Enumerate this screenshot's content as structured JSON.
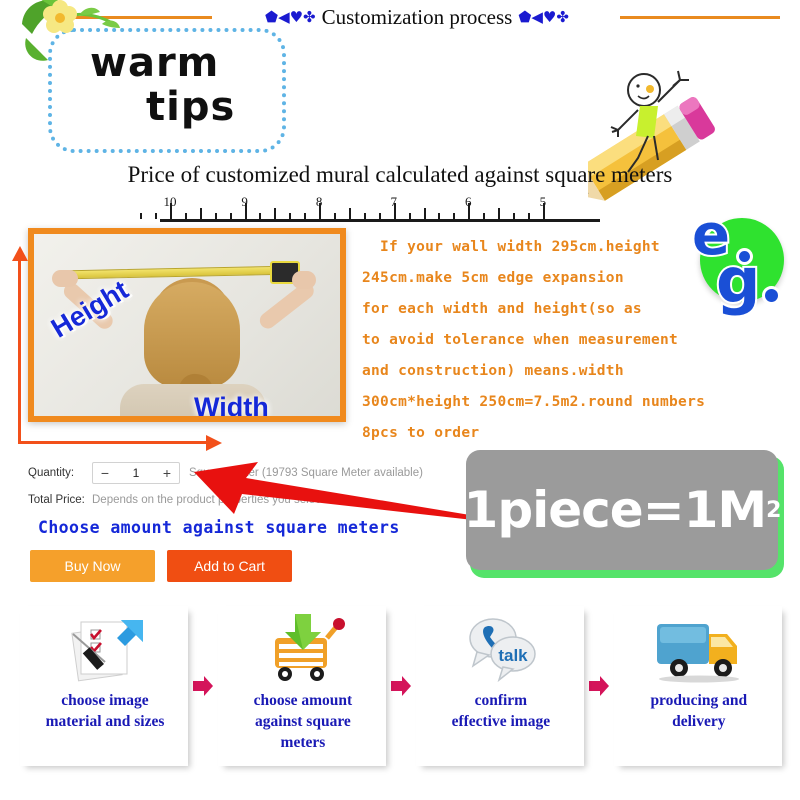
{
  "header": {
    "title": "Customization process",
    "suits_left": "⬟◀♥✤",
    "suits_right": "⬟◀♥✤",
    "rule_color": "#E98A1F"
  },
  "tips_box": {
    "line1": "warm",
    "line2": "tips",
    "border_color": "#5FB4E5",
    "flower_color": "#F2E06A",
    "leaf_color": "#62B82E"
  },
  "subheading": "Price of customized mural calculated against square meters",
  "ruler": {
    "numbers": [
      "10",
      "9",
      "8",
      "7",
      "6",
      "5"
    ]
  },
  "photo": {
    "height_label": "Height",
    "width_label": "Width",
    "frame_color": "#F08A1E",
    "axis_color": "#F2501A",
    "label_color": "#1528D8"
  },
  "eg_badge": {
    "letter_e": "e",
    "letter_g": "g",
    "circle_color": "#2FE22F",
    "letter_color": "#1A4FD6"
  },
  "paragraph": {
    "color": "#E8861C",
    "lines": [
      "If your wall width 295cm.height",
      "245cm.make 5cm edge expansion",
      "for each width and height(so as",
      "to avoid tolerance when measurement",
      "and construction) means.width",
      "300cm*height 250cm=7.5m2.round numbers",
      "8pcs to order"
    ]
  },
  "order_form": {
    "quantity_label": "Quantity:",
    "minus": "−",
    "quantity_value": "1",
    "plus": "+",
    "availability": "Square Meter (19793 Square Meter available)",
    "total_price_label": "Total Price:",
    "total_price_value": "Depends on the product properties you select"
  },
  "blue_caption": "Choose amount against square meters",
  "buttons": {
    "buy_now": "Buy Now",
    "add_to_cart": "Add to Cart",
    "buy_color": "#F5A02B",
    "cart_color": "#F04E12"
  },
  "piece_badge": {
    "text": "1piece=1M",
    "superscript": "2",
    "body_color": "#9B9B9B",
    "shadow_color": "#55E36A"
  },
  "arrow": {
    "color": "#E8110F"
  },
  "steps": [
    {
      "label_line1": "choose image",
      "label_line2": "material and sizes",
      "icon": "document-checklist-icon"
    },
    {
      "label_line1": "choose amount",
      "label_line2": "against square",
      "label_line3": "meters",
      "icon": "shopping-cart-icon"
    },
    {
      "label_line1": "confirm",
      "label_line2": "effective image",
      "icon": "talk-bubble-icon"
    },
    {
      "label_line1": "producing and",
      "label_line2": "delivery",
      "icon": "delivery-truck-icon"
    }
  ],
  "step_arrow_color": "#D4145A"
}
